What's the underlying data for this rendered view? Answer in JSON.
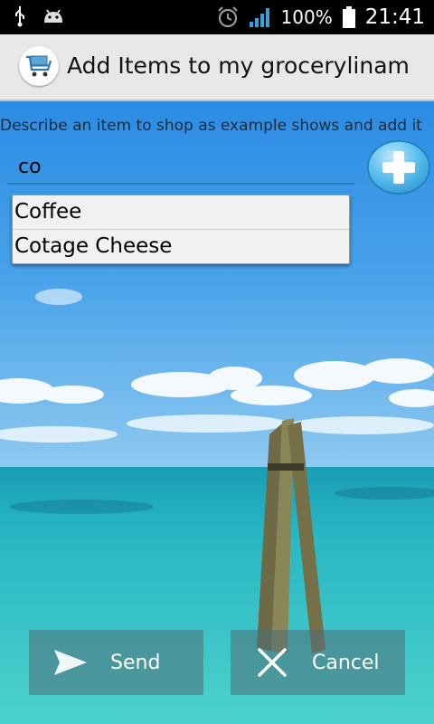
{
  "status_bar": {
    "battery": "100%",
    "time": "21:41",
    "icons": [
      "usb-icon",
      "android-icon",
      "alarm-icon",
      "signal-icon",
      "battery-icon"
    ]
  },
  "title_bar": {
    "title": "Add Items to my grocerylinam",
    "icon": "shopping-cart-app-icon"
  },
  "form": {
    "instruction": "Describe an item to shop as example shows and add it",
    "input_value": "co",
    "add_button_icon": "plus-icon",
    "accent_color": "#2a7fb8"
  },
  "suggestions": [
    {
      "label": "Coffee"
    },
    {
      "label": "Cotage Cheese"
    }
  ],
  "buttons": {
    "send": {
      "label": "Send",
      "icon": "send-arrow-icon"
    },
    "cancel": {
      "label": "Cancel",
      "icon": "close-x-icon"
    }
  }
}
